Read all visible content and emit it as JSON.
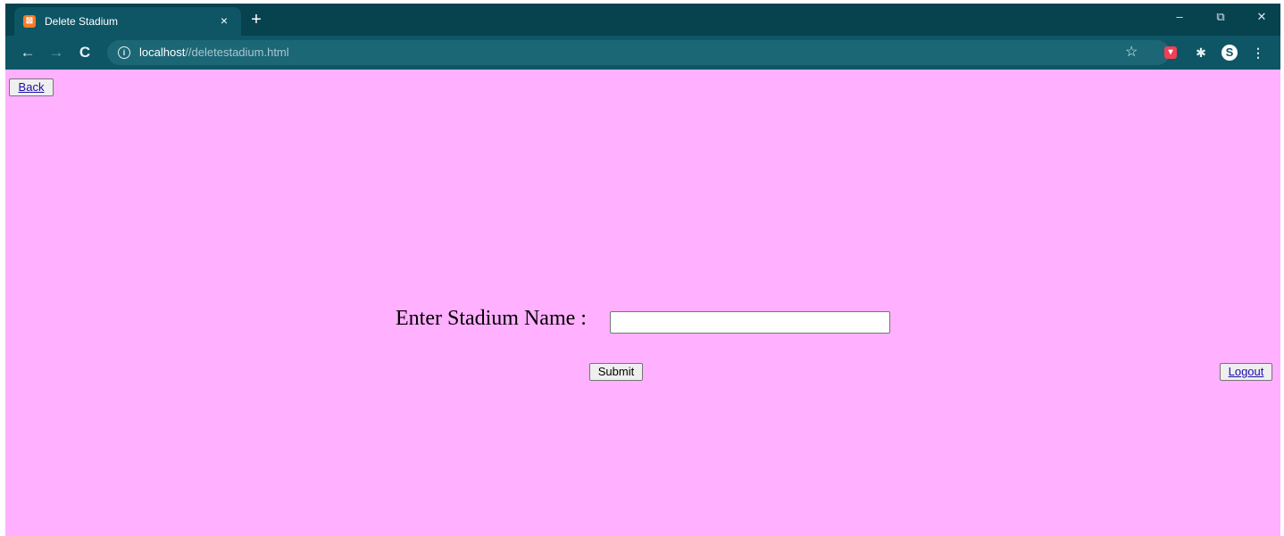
{
  "browser": {
    "tab_title": "Delete Stadium",
    "tab_favicon": "xampp-icon",
    "tab_close": "×",
    "new_tab": "+",
    "window_controls": {
      "minimize": "–",
      "restore": "⧉",
      "close": "✕"
    },
    "nav": {
      "back": "←",
      "forward": "→",
      "reload": "C"
    },
    "url_host": "localhost",
    "url_path": "//deletestadium.html",
    "info_glyph": "i",
    "star": "☆",
    "extensions": [
      "pocket-icon",
      "puzzle-icon",
      "profile-icon",
      "menu-icon"
    ]
  },
  "page": {
    "background": "#ffb0ff",
    "back_label": "Back",
    "field_label": "Enter Stadium Name :",
    "stadium_name_value": "",
    "submit_label": "Submit",
    "logout_label": "Logout"
  }
}
